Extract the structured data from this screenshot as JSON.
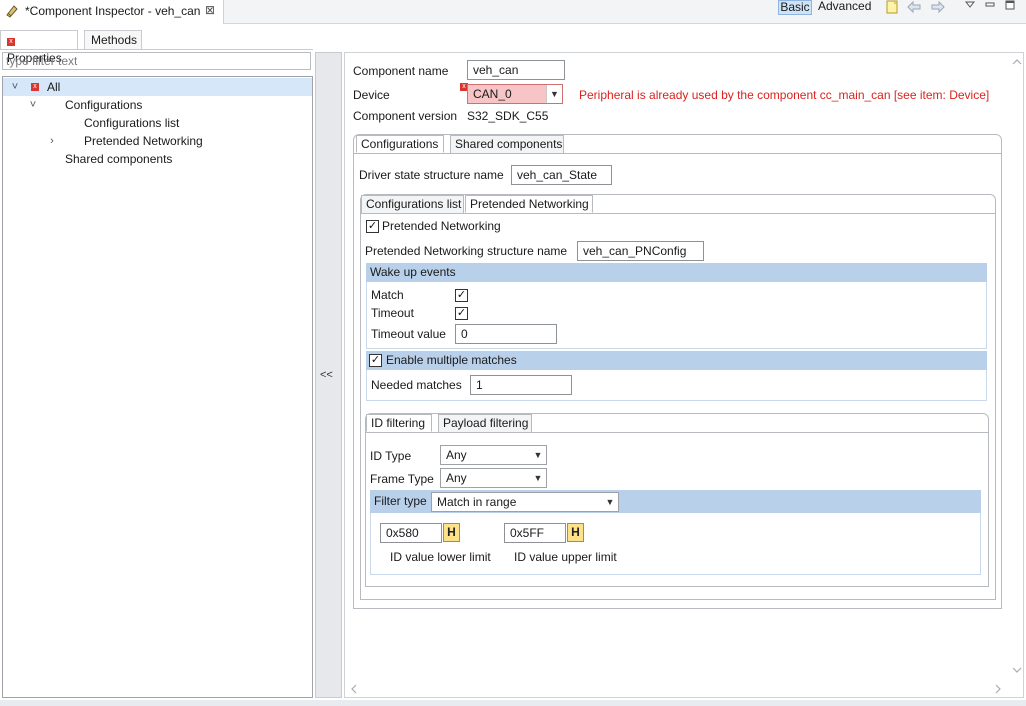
{
  "view": {
    "title": "*Component Inspector - veh_can",
    "close_glyph": "⊠",
    "icon": "component-inspector-icon"
  },
  "toolbar": {
    "basic_label": "Basic",
    "advanced_label": "Advanced",
    "icons": [
      "note-icon",
      "back-arrow-icon",
      "forward-arrow-icon",
      "view-menu-icon",
      "minimize-icon",
      "maximize-icon"
    ]
  },
  "left": {
    "tabs": [
      {
        "label": "Properties"
      },
      {
        "label": "Methods"
      }
    ],
    "filter_placeholder": "type filter text",
    "tree": [
      {
        "label": "All"
      },
      {
        "label": "Configurations"
      },
      {
        "label": "Configurations list"
      },
      {
        "label": "Pretended Networking"
      },
      {
        "label": "Shared components"
      }
    ]
  },
  "splitter": {
    "label": "<<"
  },
  "main": {
    "component_name_label": "Component name",
    "component_name_value": "veh_can",
    "device_label": "Device",
    "device_value": "CAN_0",
    "device_error": "Peripheral is already used by the component cc_main_can [see item: Device]",
    "component_version_label": "Component version",
    "component_version_value": "S32_SDK_C55",
    "outer_tabs": [
      {
        "label": "Configurations"
      },
      {
        "label": "Shared components"
      }
    ],
    "driver_state_label": "Driver state structure name",
    "driver_state_value": "veh_can_State",
    "inner_tabs": [
      {
        "label": "Configurations list"
      },
      {
        "label": "Pretended Networking"
      }
    ],
    "pn": {
      "enable_label": "Pretended Networking",
      "enable_checked": true,
      "struct_label": "Pretended Networking structure name",
      "struct_value": "veh_can_PNConfig",
      "wakeup_header": "Wake up events",
      "match_label": "Match",
      "match_checked": true,
      "timeout_label": "Timeout",
      "timeout_checked": true,
      "timeout_value_label": "Timeout value",
      "timeout_value": "0",
      "multi_label": "Enable multiple matches",
      "multi_checked": true,
      "needed_label": "Needed matches",
      "needed_value": "1"
    },
    "filter_tabs": [
      {
        "label": "ID filtering"
      },
      {
        "label": "Payload filtering"
      }
    ],
    "idf": {
      "id_type_label": "ID Type",
      "id_type_value": "Any",
      "frame_type_label": "Frame Type",
      "frame_type_value": "Any",
      "filter_type_label": "Filter type",
      "filter_type_value": "Match in range",
      "lower_value": "0x580",
      "upper_value": "0x5FF",
      "hex_label": "H",
      "lower_label": "ID value lower limit",
      "upper_label": "ID value upper limit"
    }
  },
  "colors": {
    "selection": "#d6e7f9",
    "section_header": "#b9d0ea",
    "error": "#d9231e",
    "device_field_bg": "#f7c5c5",
    "hex_button": "#fde28a"
  }
}
